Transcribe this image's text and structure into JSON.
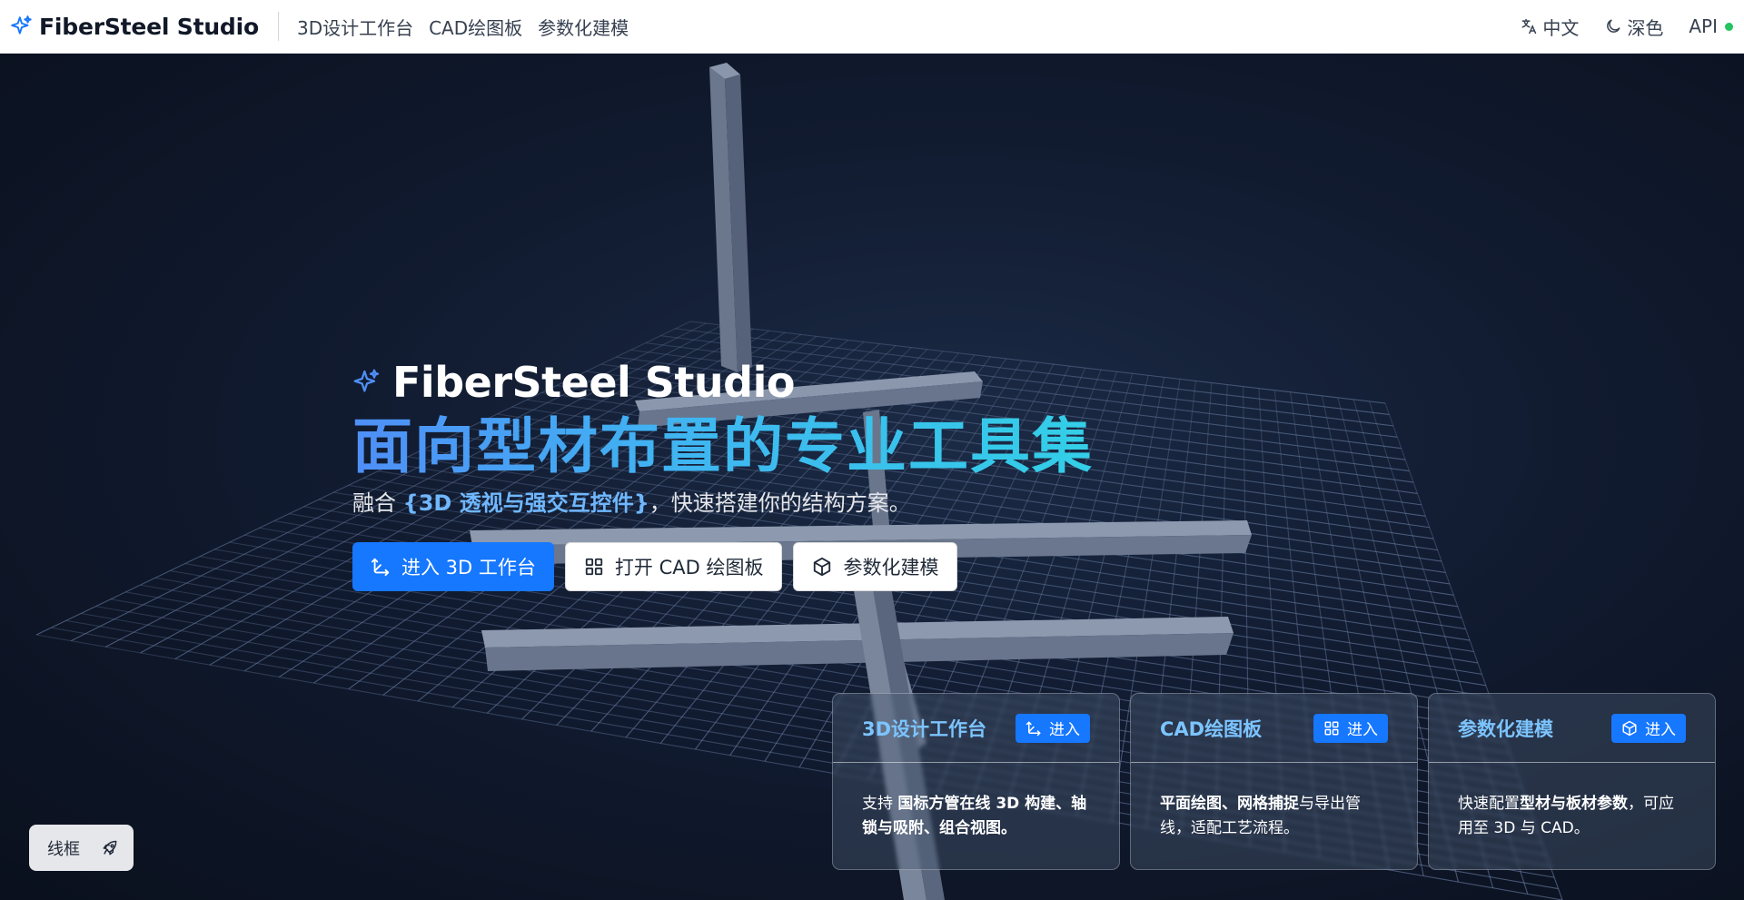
{
  "header": {
    "brand": "FiberSteel Studio",
    "brand_icon": "sparkles-icon",
    "nav": [
      "3D设计工作台",
      "CAD绘图板",
      "参数化建模"
    ],
    "language": "中文",
    "theme": "深色",
    "api_label": "API",
    "api_status_color": "#22c55e"
  },
  "hero": {
    "title": "FiberSteel Studio",
    "headline": "面向型材布置的专业工具集",
    "subtitle_prefix": "融合 ",
    "subtitle_highlight": "{3D 透视与强交互控件}",
    "subtitle_suffix": "，快速搭建你的结构方案。",
    "buttons": {
      "primary": "进入 3D 工作台",
      "cad": "打开 CAD 绘图板",
      "param": "参数化建模"
    }
  },
  "cards": [
    {
      "title": "3D设计工作台",
      "button": "进入",
      "icon": "axis-icon",
      "text_prefix": "支持 ",
      "text_bold": "国标方管在线 3D 构建、轴锁与吸附、组合视图。",
      "text_suffix": ""
    },
    {
      "title": "CAD绘图板",
      "button": "进入",
      "icon": "grid-icon",
      "text_prefix": "",
      "text_bold": "平面绘图、网格捕捉",
      "text_suffix": "与导出管线，适配工艺流程。"
    },
    {
      "title": "参数化建模",
      "button": "进入",
      "icon": "cube-icon",
      "text_prefix": "快速配置",
      "text_bold": "型材与板材参数",
      "text_suffix": "，可应用至 3D 与 CAD。"
    }
  ],
  "wireframe_toggle": "线框",
  "colors": {
    "primary": "#1677ff",
    "accent_text": "#7cc4ff",
    "background": "#0b1220"
  }
}
